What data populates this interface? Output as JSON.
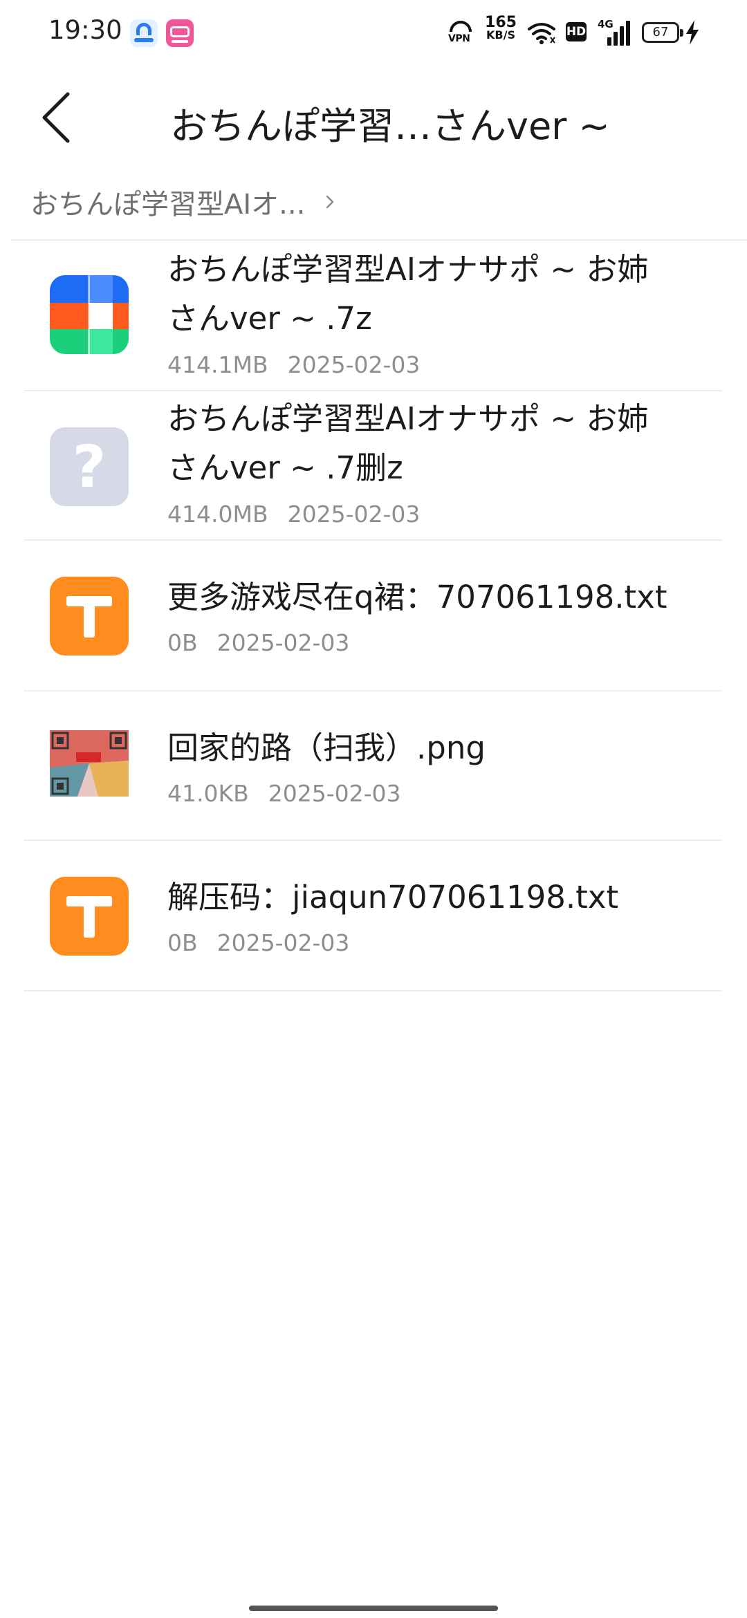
{
  "status_bar": {
    "time": "19:30",
    "vpn_label": "VPN",
    "net_speed_value": "165",
    "net_speed_unit": "KB/S",
    "hd_label": "HD",
    "network_type": "4G",
    "battery": "67",
    "charging": true
  },
  "header": {
    "title": "おちんぽ学習…さんver ~"
  },
  "breadcrumb": {
    "items": [
      "おちんぽ学習型AIオ..."
    ]
  },
  "files": [
    {
      "name": "おちんぽ学習型AIオナサポ ~ お姉さんver ~ .7z",
      "size": "414.1MB",
      "date": "2025-02-03",
      "icon": "archive-icon"
    },
    {
      "name": "おちんぽ学習型AIオナサポ ~ お姉さんver ~ .7删z",
      "size": "414.0MB",
      "date": "2025-02-03",
      "icon": "unknown-file-icon"
    },
    {
      "name": "更多游戏尽在q裙：707061198.txt",
      "size": "0B",
      "date": "2025-02-03",
      "icon": "text-file-icon"
    },
    {
      "name": "回家的路（扫我）.png",
      "size": "41.0KB",
      "date": "2025-02-03",
      "icon": "image-thumbnail"
    },
    {
      "name": "解压码：jiaqun707061198.txt",
      "size": "0B",
      "date": "2025-02-03",
      "icon": "text-file-icon"
    }
  ],
  "colors": {
    "text_file_orange": "#ff8c1f",
    "unknown_file_gray": "#d6d9e6",
    "archive_blue": "#1e6cf5",
    "archive_orange": "#ff5a1e",
    "archive_green": "#1ccf7a"
  }
}
